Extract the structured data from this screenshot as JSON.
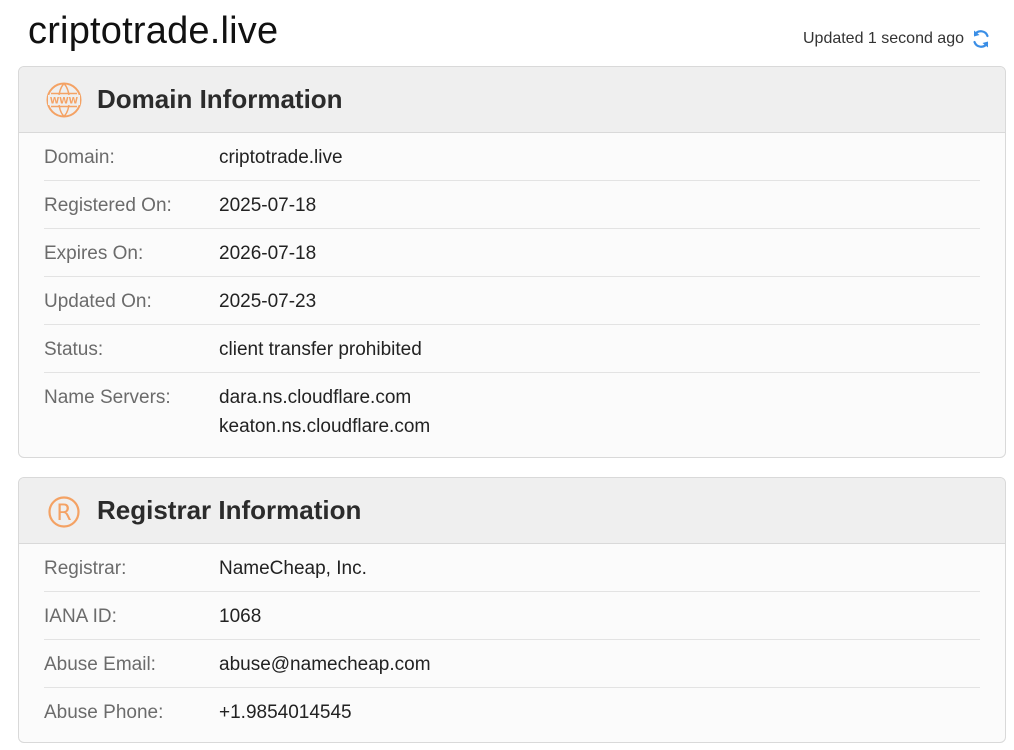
{
  "header": {
    "domain_title": "criptotrade.live",
    "updated_text": "Updated 1 second ago"
  },
  "icons": {
    "refresh": "refresh-icon",
    "www": "www-globe-icon",
    "registered": "registered-trademark-icon"
  },
  "colors": {
    "accent_orange": "#f4a264",
    "refresh_blue": "#3a8ee6"
  },
  "domain_info": {
    "title": "Domain Information",
    "rows": [
      {
        "label": "Domain:",
        "value": "criptotrade.live"
      },
      {
        "label": "Registered On:",
        "value": "2025-07-18"
      },
      {
        "label": "Expires On:",
        "value": "2026-07-18"
      },
      {
        "label": "Updated On:",
        "value": "2025-07-23"
      },
      {
        "label": "Status:",
        "value": "client transfer prohibited"
      }
    ],
    "name_servers": {
      "label": "Name Servers:",
      "values": [
        "dara.ns.cloudflare.com",
        "keaton.ns.cloudflare.com"
      ]
    }
  },
  "registrar_info": {
    "title": "Registrar Information",
    "rows": [
      {
        "label": "Registrar:",
        "value": "NameCheap, Inc."
      },
      {
        "label": "IANA ID:",
        "value": "1068"
      },
      {
        "label": "Abuse Email:",
        "value": "abuse@namecheap.com"
      },
      {
        "label": "Abuse Phone:",
        "value": "+1.9854014545"
      }
    ]
  }
}
